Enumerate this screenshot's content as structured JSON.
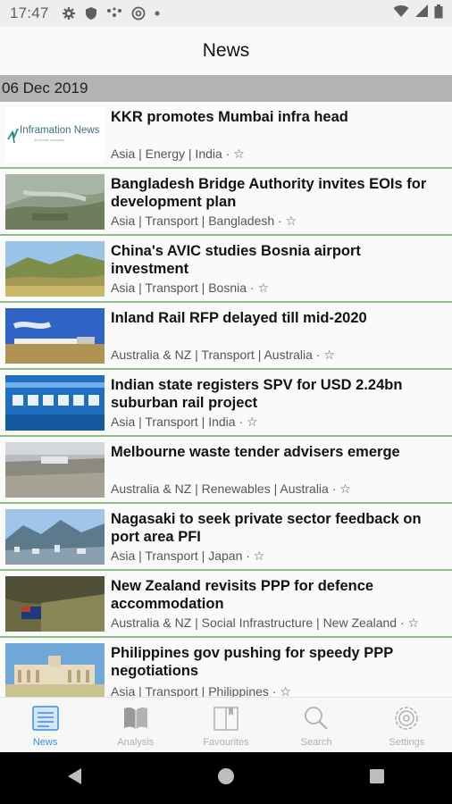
{
  "status_bar": {
    "time": "17:47"
  },
  "app_bar": {
    "title": "News"
  },
  "date_header": "06 Dec 2019",
  "articles": [
    {
      "title": "KKR promotes Mumbai infra head",
      "meta": "Asia | Energy | India · ",
      "star": "☆",
      "thumb_logo": "Inframation News",
      "thumb_sub": "An Acuris company"
    },
    {
      "title": "Bangladesh Bridge Authority invites EOIs for development plan",
      "meta": "Asia | Transport | Bangladesh · ",
      "star": "☆"
    },
    {
      "title": "China's AVIC studies Bosnia airport investment",
      "meta": "Asia | Transport | Bosnia · ",
      "star": "☆"
    },
    {
      "title": "Inland Rail RFP delayed till mid-2020",
      "meta": "Australia & NZ | Transport | Australia · ",
      "star": "☆"
    },
    {
      "title": "Indian state registers SPV for USD 2.24bn suburban rail project",
      "meta": "Asia | Transport | India · ",
      "star": "☆"
    },
    {
      "title": "Melbourne waste tender advisers emerge",
      "meta": "Australia & NZ | Renewables | Australia · ",
      "star": "☆"
    },
    {
      "title": "Nagasaki to seek private sector feedback on port area PFI",
      "meta": "Asia | Transport | Japan · ",
      "star": "☆"
    },
    {
      "title": "New Zealand revisits PPP for defence accommodation",
      "meta": "Australia & NZ | Social Infrastructure | New Zealand · ",
      "star": "☆"
    },
    {
      "title": "Philippines gov pushing for speedy PPP negotiations",
      "meta": "Asia | Transport | Philippines · ",
      "star": "☆"
    }
  ],
  "bottom_nav": [
    {
      "label": "News",
      "icon": "news-icon",
      "active": true
    },
    {
      "label": "Analysis",
      "icon": "book-icon",
      "active": false
    },
    {
      "label": "Favourites",
      "icon": "bookmark-book-icon",
      "active": false
    },
    {
      "label": "Search",
      "icon": "search-icon",
      "active": false
    },
    {
      "label": "Settings",
      "icon": "gear-icon",
      "active": false
    }
  ],
  "colors": {
    "accent": "#3a8ee6",
    "divider": "#8dbf87",
    "date_header_bg": "#b3b3b3"
  }
}
